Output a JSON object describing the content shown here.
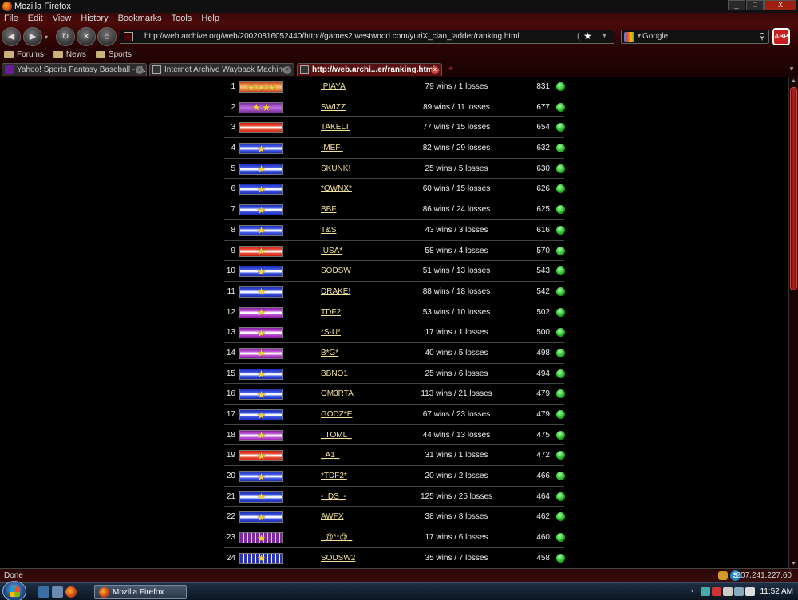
{
  "window": {
    "title": "Mozilla Firefox",
    "buttons": [
      "_",
      "□",
      "X"
    ]
  },
  "menu": [
    "File",
    "Edit",
    "View",
    "History",
    "Bookmarks",
    "Tools",
    "Help"
  ],
  "nav": {
    "back": "◀",
    "forward": "▶",
    "dropdown": "▾",
    "reload": "↻",
    "stop": "✕",
    "home": "⌂",
    "url": "http://web.archive.org/web/20020816052440/http://games2.westwood.com/yuriX_clan_ladder/ranking.html",
    "star": "★",
    "url_dropdown": "▼",
    "search_placeholder": "Google",
    "search_dropdown": "▼",
    "search_icon": "⚲",
    "adblock": "ABP"
  },
  "bookmarks": [
    "Forums",
    "News",
    "Sports"
  ],
  "tabs": [
    {
      "label": "Yahoo! Sports Fantasy Baseball - Y...",
      "icon": "yahoo-icon",
      "active": false
    },
    {
      "label": "Internet Archive Wayback Machine",
      "icon": "page-icon",
      "active": false
    },
    {
      "label": "http://web.archi...er/ranking.html",
      "icon": "page-icon",
      "active": true
    }
  ],
  "tab_controls": {
    "close": "x",
    "new_tab": "+",
    "list": "▼"
  },
  "ladder": [
    {
      "rank": "1",
      "clan": "!PIAYA",
      "record": "79 wins / 1 losses",
      "points": "831",
      "badge": "orange",
      "stars": 3
    },
    {
      "rank": "2",
      "clan": "SWIZZ",
      "record": "89 wins / 11 losses",
      "points": "677",
      "badge": "purple",
      "stars": 2
    },
    {
      "rank": "3",
      "clan": "TAKELT",
      "record": "77 wins / 15 losses",
      "points": "654",
      "badge": "red",
      "stars": 0
    },
    {
      "rank": "4",
      "clan": "-MEF-",
      "record": "82 wins / 29 losses",
      "points": "632",
      "badge": "blue",
      "stars": 1
    },
    {
      "rank": "5",
      "clan": "SKUNK!",
      "record": "25 wins / 5 losses",
      "points": "630",
      "badge": "blue",
      "stars": 1
    },
    {
      "rank": "6",
      "clan": "*OWNX*",
      "record": "60 wins / 15 losses",
      "points": "626",
      "badge": "blue",
      "stars": 1
    },
    {
      "rank": "7",
      "clan": "BBF",
      "record": "86 wins / 24 losses",
      "points": "625",
      "badge": "blue",
      "stars": 1
    },
    {
      "rank": "8",
      "clan": "T&S",
      "record": "43 wins / 3 losses",
      "points": "616",
      "badge": "blue",
      "stars": 1
    },
    {
      "rank": "9",
      "clan": ".USA*",
      "record": "58 wins / 4 losses",
      "points": "570",
      "badge": "red",
      "stars": 1
    },
    {
      "rank": "10",
      "clan": "SODSW",
      "record": "51 wins / 13 losses",
      "points": "543",
      "badge": "blue",
      "stars": 1
    },
    {
      "rank": "11",
      "clan": "DRAKE!",
      "record": "88 wins / 18 losses",
      "points": "542",
      "badge": "blue",
      "stars": 1
    },
    {
      "rank": "12",
      "clan": "TDF2",
      "record": "53 wins / 10 losses",
      "points": "502",
      "badge": "magenta",
      "stars": 1
    },
    {
      "rank": "13",
      "clan": "*S-U*",
      "record": "17 wins / 1 losses",
      "points": "500",
      "badge": "magenta",
      "stars": 1
    },
    {
      "rank": "14",
      "clan": "B*G*",
      "record": "40 wins / 5 losses",
      "points": "498",
      "badge": "magenta",
      "stars": 1
    },
    {
      "rank": "15",
      "clan": "BBNO1",
      "record": "25 wins / 6 losses",
      "points": "494",
      "badge": "blue",
      "stars": 1
    },
    {
      "rank": "16",
      "clan": "OM3RTA",
      "record": "113 wins / 21 losses",
      "points": "479",
      "badge": "blue",
      "stars": 1
    },
    {
      "rank": "17",
      "clan": "GODZ*E",
      "record": "67 wins / 23 losses",
      "points": "479",
      "badge": "blue",
      "stars": 1
    },
    {
      "rank": "18",
      "clan": "_TOML_",
      "record": "44 wins / 13 losses",
      "points": "475",
      "badge": "magenta",
      "stars": 1
    },
    {
      "rank": "19",
      "clan": "_A1_",
      "record": "31 wins / 1 losses",
      "points": "472",
      "badge": "red",
      "stars": 1
    },
    {
      "rank": "20",
      "clan": "*TDF2*",
      "record": "20 wins / 2 losses",
      "points": "466",
      "badge": "blue",
      "stars": 1
    },
    {
      "rank": "21",
      "clan": "-_DS_-",
      "record": "125 wins / 25 losses",
      "points": "464",
      "badge": "blue",
      "stars": 1
    },
    {
      "rank": "22",
      "clan": "AWFX",
      "record": "38 wins / 8 losses",
      "points": "462",
      "badge": "blue",
      "stars": 1
    },
    {
      "rank": "23",
      "clan": "_@**@_",
      "record": "17 wins / 6 losses",
      "points": "460",
      "badge": "stripe-purple",
      "stars": 1
    },
    {
      "rank": "24",
      "clan": "SODSW2",
      "record": "35 wins / 7 losses",
      "points": "458",
      "badge": "stripe-blue",
      "stars": 1
    }
  ],
  "status": {
    "text": "Done",
    "ip": "207.241.227.60",
    "s_icon": "S"
  },
  "scroll": {
    "up": "▲",
    "down": "▼",
    "position": 0.0
  },
  "taskbar": {
    "task_label": "Mozilla Firefox",
    "clock": "11:52 AM",
    "tray_chevron": "‹"
  },
  "colors": {
    "accent": "#b42020",
    "link": "#f2e29a",
    "online": "#22bb22"
  }
}
